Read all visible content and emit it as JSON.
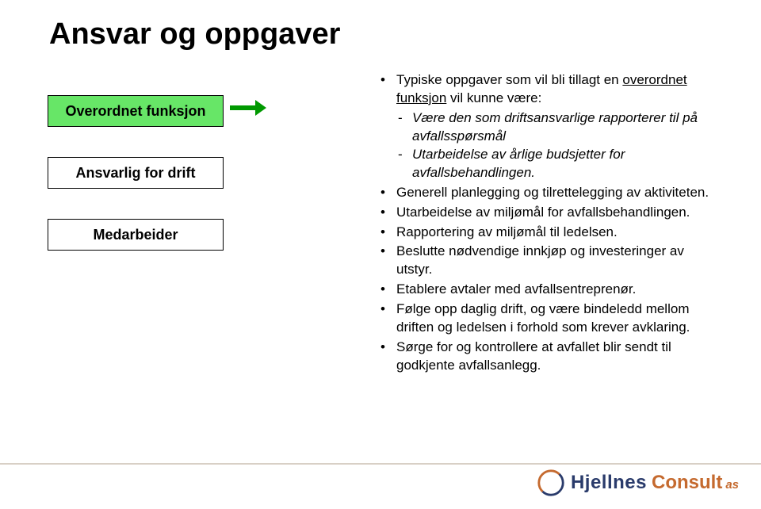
{
  "title": "Ansvar og oppgaver",
  "boxes": {
    "top": "Overordnet funksjon",
    "mid": "Ansvarlig for drift",
    "bottom": "Medarbeider"
  },
  "content": {
    "intro_a": "Typiske oppgaver som vil bli tillagt en ",
    "intro_b": "overordnet funksjon",
    "intro_c": " vil kunne være:",
    "sub1": "Være den som driftsansvarlige rapporterer til på avfallsspørsmål",
    "sub2": "Utarbeidelse av årlige budsjetter for avfallsbehandlingen.",
    "b2": "Generell planlegging og tilrettelegging av aktiviteten.",
    "b3": "Utarbeidelse av miljømål for avfallsbehandlingen.",
    "b4": "Rapportering av miljømål til ledelsen.",
    "b5": "Beslutte nødvendige innkjøp og investeringer av utstyr.",
    "b6": "Etablere avtaler med avfallsentreprenør.",
    "b7": "Følge opp daglig drift, og være bindeledd mellom driften og ledelsen i forhold som krever avklaring.",
    "b8": "Sørge for og kontrollere at avfallet blir sendt til godkjente avfallsanlegg."
  },
  "logo": {
    "name": "Hjellnes",
    "suffix": "Consult",
    "as": "as"
  }
}
